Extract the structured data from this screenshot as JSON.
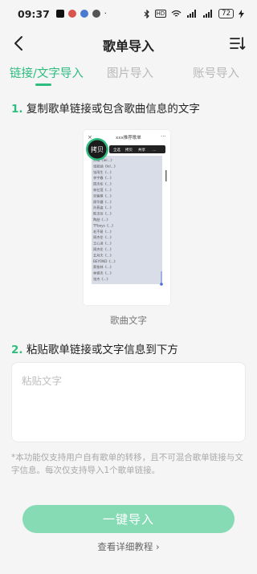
{
  "status_bar": {
    "time": "09:37",
    "battery": "72"
  },
  "nav": {
    "title": "歌单导入"
  },
  "tabs": [
    {
      "label": "链接/文字导入",
      "active": true
    },
    {
      "label": "图片导入",
      "active": false
    },
    {
      "label": "账号导入",
      "active": false
    }
  ],
  "step1": {
    "num": "1.",
    "text": "复制歌单链接或包含歌曲信息的文字"
  },
  "illustration": {
    "header_title": "xxx推荐歌单",
    "copy_label": "拷贝",
    "menu_items": [
      "全选",
      "拷贝",
      "共享",
      "..."
    ],
    "songs": [
      "刘瑞《Iel...》",
      "张韶涵《Iel...》",
      "张雨生《...》",
      "李宇春《...》",
      "周杰伦《...》",
      "林忆莲《...》",
      "邓紫棋《...》",
      "周华健《...》",
      "孙燕姿《...》",
      "陈洁仪《...》",
      "陶喆《...》",
      "TFboys《...》",
      "毛不易《...》",
      "周杰伦《...》",
      "王心凌《...》",
      "周杰伦《...》",
      "五月天《...》",
      "BEYOND《...》",
      "蔡依林《...》",
      "林俊杰《...》",
      "张杰《...》"
    ],
    "caption": "歌曲文字"
  },
  "step2": {
    "num": "2.",
    "text": "粘贴歌单链接或文字信息到下方"
  },
  "paste_box": {
    "placeholder": "粘贴文字"
  },
  "notice": "*本功能仅支持用户自有歌单的转移，且不可混合歌单链接与文字信息。每次仅支持导入1个歌单链接。",
  "import_button": "一键导入",
  "tutorial_link": "查看详细教程",
  "colors": {
    "accent": "#2ebd7f",
    "button": "#86dbb5",
    "background": "#f4f5f4"
  }
}
